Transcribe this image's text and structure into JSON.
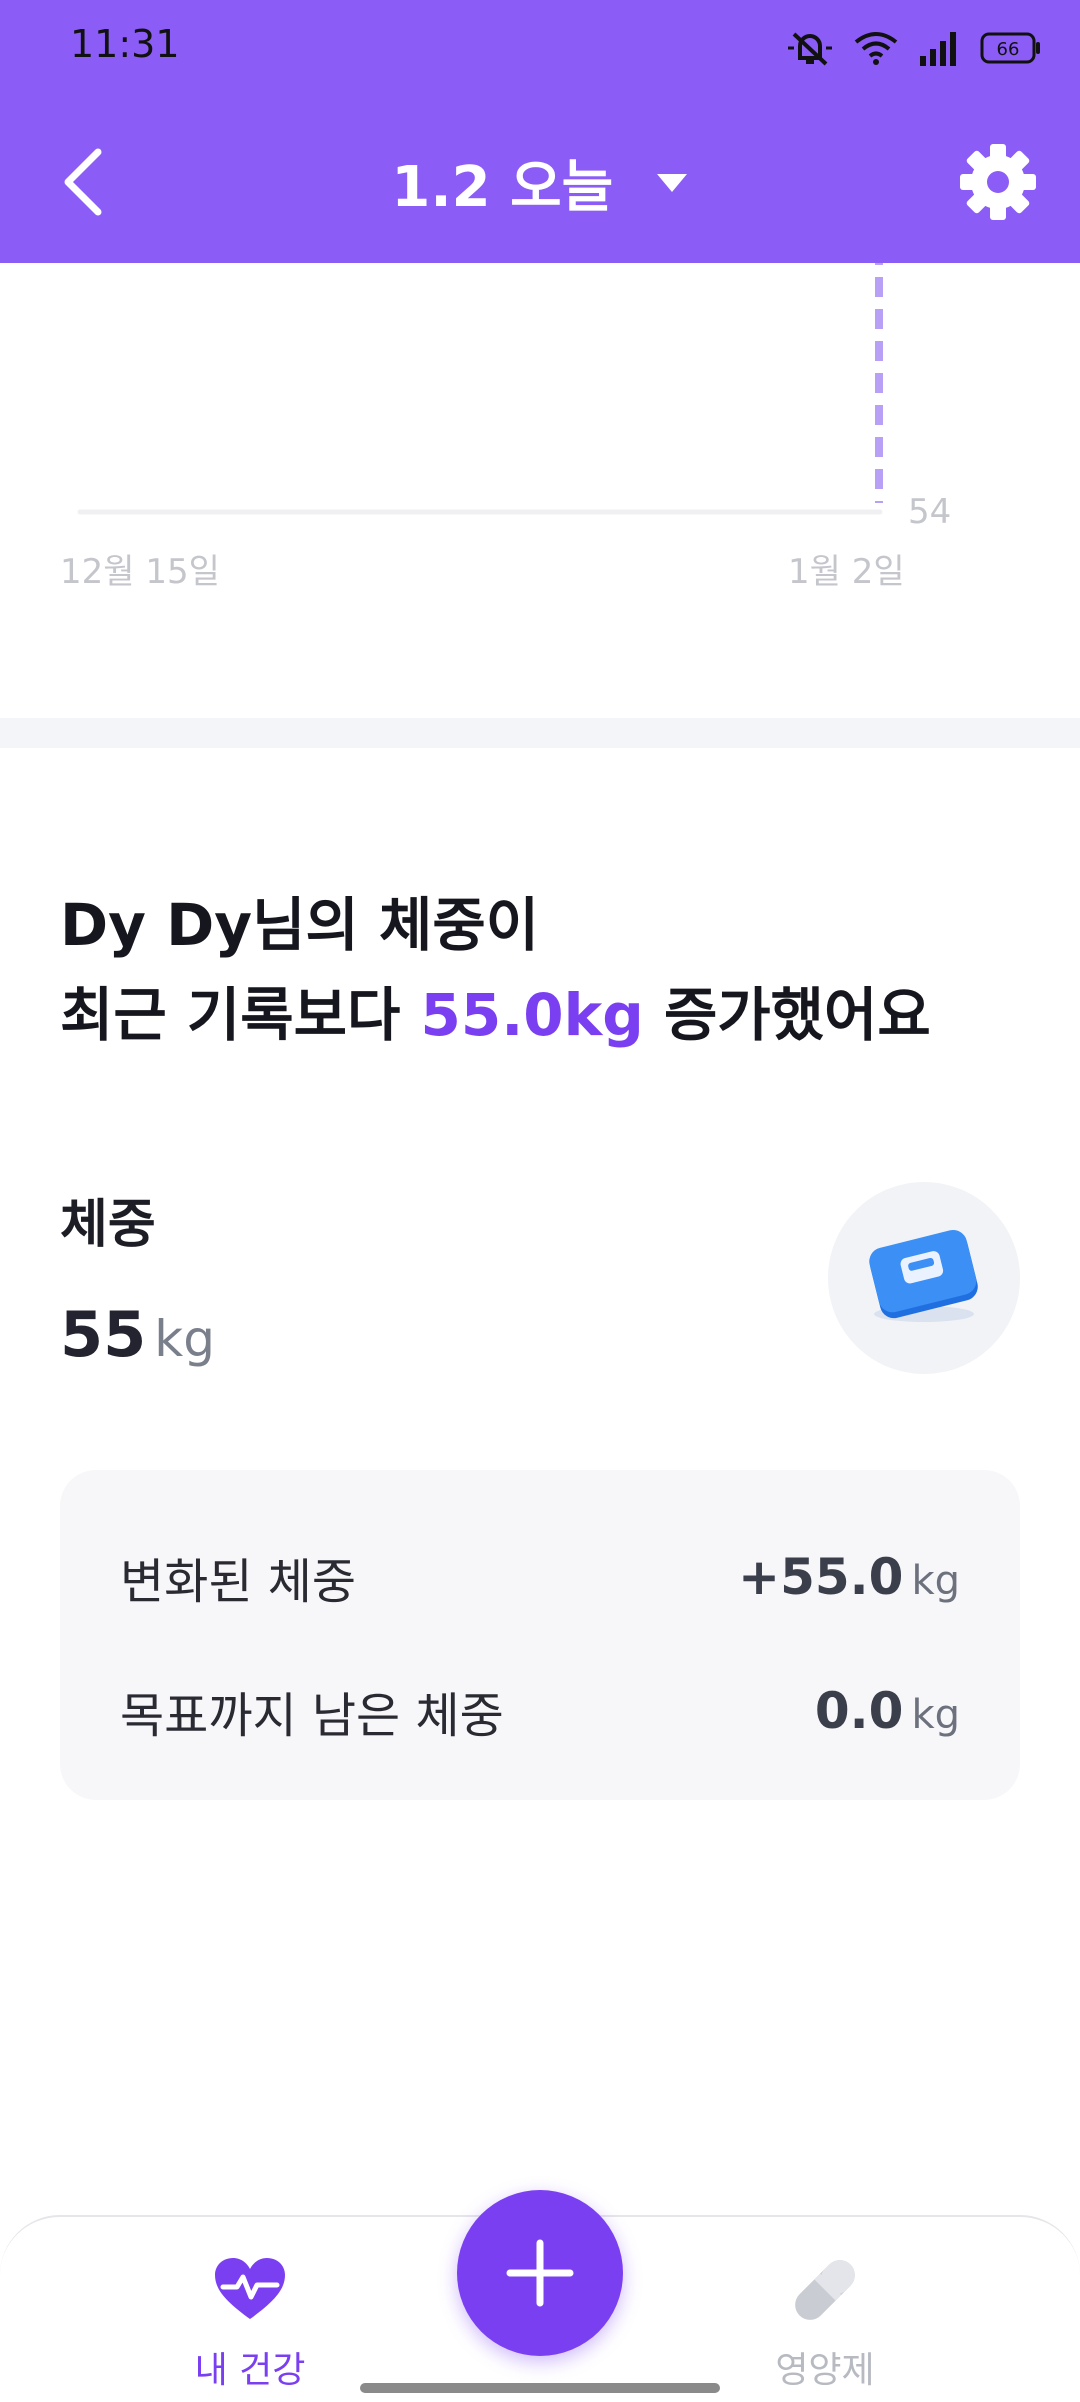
{
  "status_bar": {
    "time": "11:31",
    "battery": "66",
    "icons": [
      "mute-icon",
      "wifi-icon",
      "signal-icon",
      "battery-icon"
    ]
  },
  "header": {
    "title": "1.2 오늘",
    "back_icon": "chevron-left-icon",
    "dropdown_icon": "caret-down-icon",
    "settings_icon": "gear-icon"
  },
  "chart_data": {
    "type": "line",
    "x": [
      "12월 15일",
      "1월 2일"
    ],
    "series": [
      {
        "values": [
          null,
          54
        ]
      }
    ],
    "y_tick_label": "54",
    "highlighted_point": "1월 2일"
  },
  "summary": {
    "line1": "Dy Dy님의 체중이",
    "line2_prefix": "최근 기록보다 ",
    "line2_accent": "55.0kg",
    "line2_suffix": " 증가했어요"
  },
  "weight": {
    "label": "체중",
    "value": "55",
    "unit": "kg",
    "icon": "scale-icon"
  },
  "stats": [
    {
      "label": "변화된 체중",
      "value": "+55.0",
      "unit": "kg"
    },
    {
      "label": "목표까지 남은 체중",
      "value": "0.0",
      "unit": "kg"
    }
  ],
  "bottom_nav": {
    "home": {
      "label": "내 건강",
      "icon": "heart-pulse-icon"
    },
    "add": {
      "icon": "plus-icon"
    },
    "supplements": {
      "label": "영양제",
      "icon": "pill-icon"
    }
  },
  "colors": {
    "brand": "#8B5CF6",
    "accent": "#7B3FF2"
  }
}
